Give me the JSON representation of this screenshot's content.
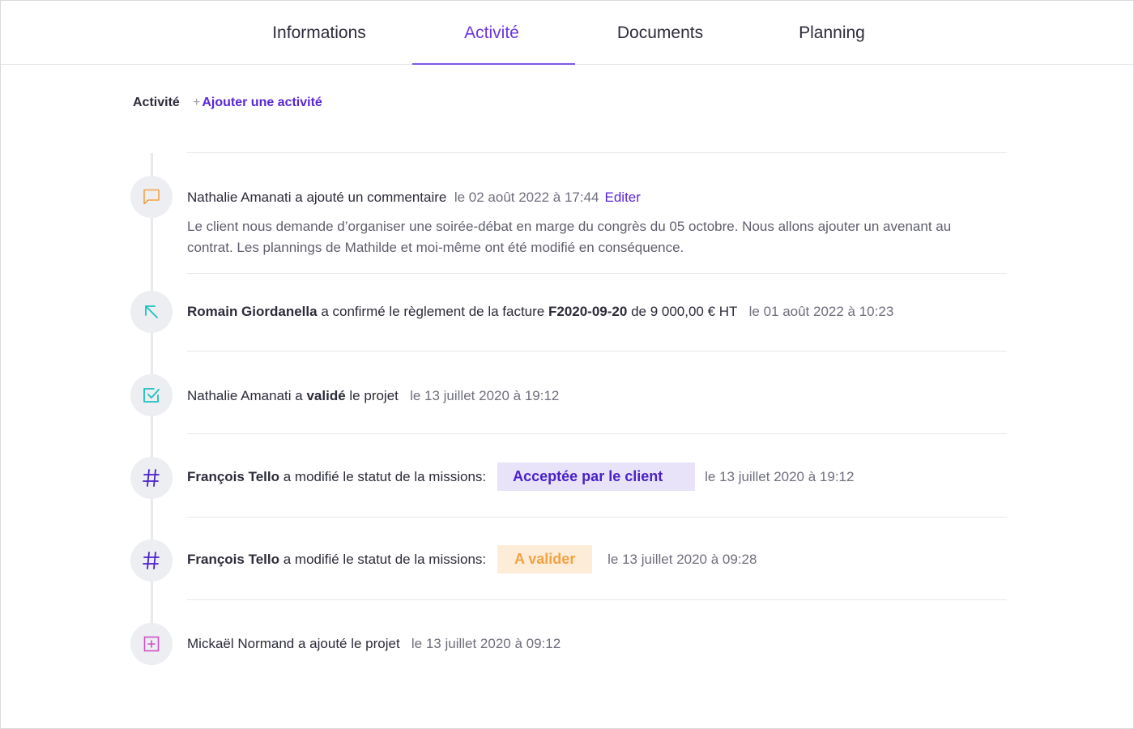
{
  "tabs": [
    {
      "label": "Informations",
      "active": false
    },
    {
      "label": "Activité",
      "active": true
    },
    {
      "label": "Documents",
      "active": false
    },
    {
      "label": "Planning",
      "active": false
    }
  ],
  "section": {
    "title": "Activité",
    "add_plus": "+",
    "add_label": "Ajouter une activité"
  },
  "colors": {
    "accent": "#6a35e6",
    "comment_icon": "#f3a243",
    "payment_icon": "#1cc2c0",
    "validate_icon": "#1cc2c0",
    "status_icon": "#4a22c8",
    "add_icon": "#d14fc8"
  },
  "activities": [
    {
      "icon": "comment-icon",
      "author": "Nathalie Amanati",
      "action": "a ajouté un commentaire",
      "date": "le 02 août 2022 à 17:44",
      "edit_label": "Editer",
      "comment": "Le client nous demande d’organiser une soirée-débat en marge du congrès du 05 octobre. Nous allons ajouter un avenant au contrat. Les plannings de Mathilde et moi-même ont été modifié en conséquence."
    },
    {
      "icon": "arrow-up-left-icon",
      "author": "Romain Giordanella",
      "action_before": "a confirmé le règlement de la facture",
      "invoice": "F2020-09-20",
      "action_after": "de 9 000,00 € HT",
      "date": "le 01 août 2022 à 10:23"
    },
    {
      "icon": "checkbox-icon",
      "author": "Nathalie Amanati",
      "action_before": "a",
      "action_bold": "validé",
      "action_after": "le projet",
      "date": "le 13 juillet 2020 à 19:12"
    },
    {
      "icon": "hash-icon",
      "author": "François Tello",
      "action": "a modifié le statut de la missions:",
      "status": "Acceptée par le client",
      "date": "le 13 juillet 2020 à 19:12"
    },
    {
      "icon": "hash-icon",
      "author": "François Tello",
      "action": "a modifié le statut de la missions:",
      "status": "A valider",
      "date": "le 13 juillet 2020 à 09:28"
    },
    {
      "icon": "plus-square-icon",
      "author": "Mickaël Normand",
      "action": "a ajouté le projet",
      "date": "le 13 juillet 2020 à 09:12"
    }
  ]
}
